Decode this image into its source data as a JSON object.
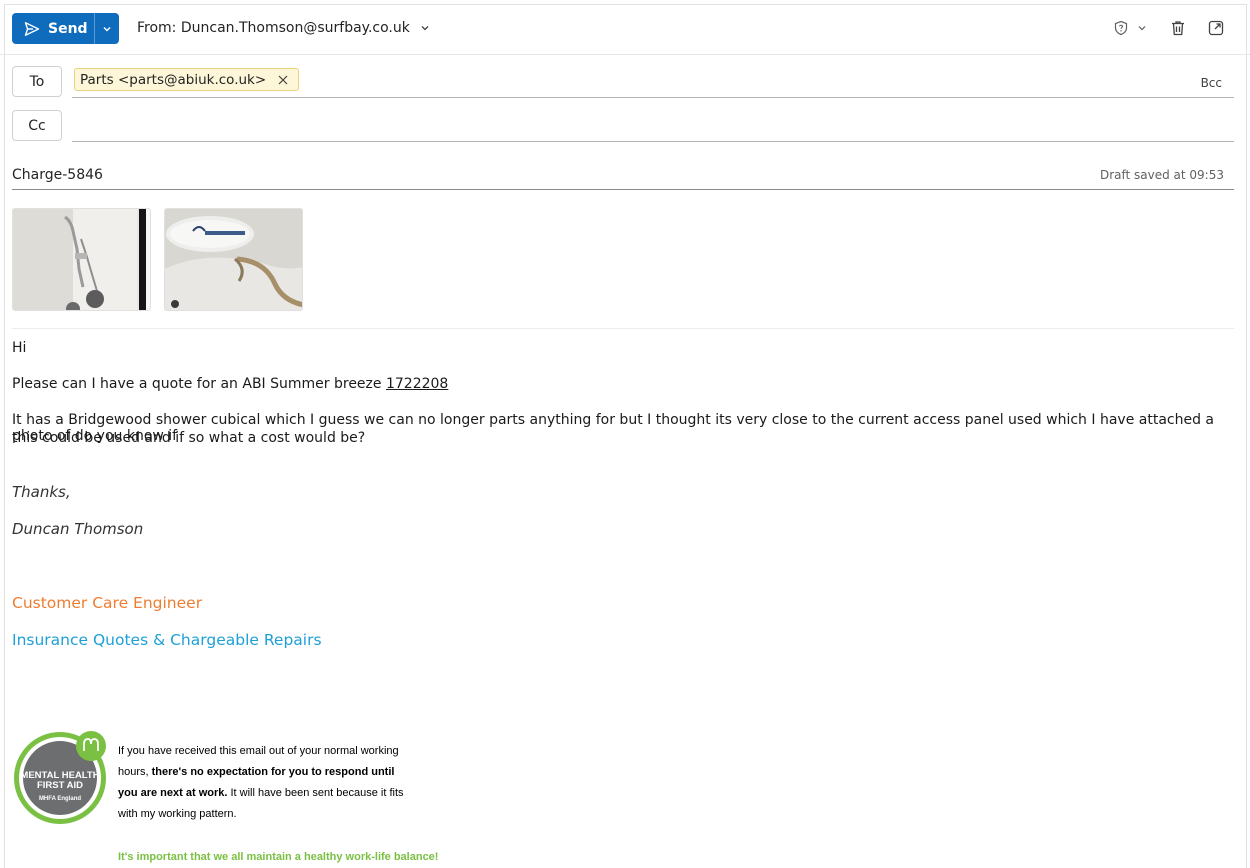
{
  "toolbar": {
    "send_label": "Send",
    "from_label": "From: Duncan.Thomson@surfbay.co.uk"
  },
  "recipients": {
    "to_label": "To",
    "cc_label": "Cc",
    "bcc_label": "Bcc",
    "to_chip": "Parts <parts@abiuk.co.uk>"
  },
  "subject": {
    "value": "Charge-5846",
    "saved_status": "Draft saved at 09:53"
  },
  "body": {
    "greeting": "Hi",
    "line1_prefix": "Please can I have a quote for an ABI Summer breeze ",
    "line1_link": "1722208",
    "para2_line1": "It has a Bridgewood shower cubical which I guess we can no longer parts anything for but I thought its very close to the current access panel used which I have attached a photo of do you know if",
    "para2_line2": "this could be used and if so what a cost would be?",
    "thanks": "Thanks,",
    "name": "Duncan Thomson"
  },
  "signature": {
    "role": "Customer Care Engineer",
    "department": "Insurance Quotes & Chargeable Repairs",
    "logo_text": [
      "MENTAL HEALTH",
      "FIRST AID",
      "MHFA England"
    ],
    "notice_line1": "If you have received this email out of your normal working",
    "notice_line2_a": "hours, ",
    "notice_line2_b": "there's no expectation for you to respond until",
    "notice_line3_a": "you are next at work.",
    "notice_line3_b": " It will have been sent because it fits",
    "notice_line4": "with my working pattern.",
    "balance_note": "It's important that we all maintain a healthy work-life balance!"
  },
  "colors": {
    "accent": "#0f6cbd",
    "role": "#ed7d31",
    "department": "#1ea0d6",
    "mhfa_green": "#7ac143"
  }
}
